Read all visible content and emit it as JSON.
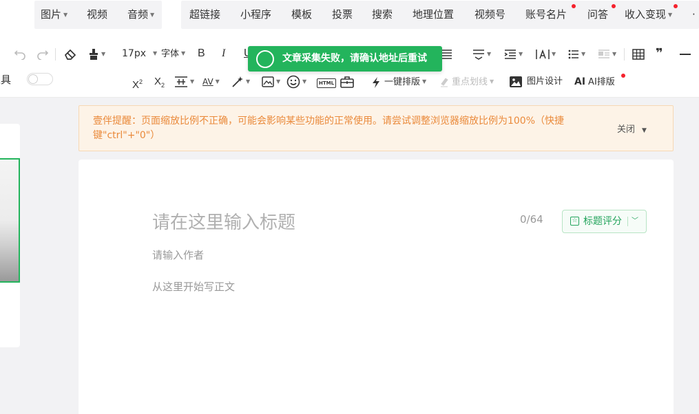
{
  "insert_bar": {
    "group1": [
      {
        "label": "图片",
        "caret": true
      },
      {
        "label": "视频",
        "caret": false
      },
      {
        "label": "音频",
        "caret": true
      }
    ],
    "group2": [
      {
        "label": "超链接",
        "dot": false
      },
      {
        "label": "小程序",
        "dot": false
      },
      {
        "label": "模板",
        "dot": false
      },
      {
        "label": "投票",
        "dot": false
      },
      {
        "label": "搜索",
        "dot": false
      },
      {
        "label": "地理位置",
        "dot": false
      },
      {
        "label": "视频号",
        "dot": false
      },
      {
        "label": "账号名片",
        "dot": true
      },
      {
        "label": "问答",
        "dot": true
      },
      {
        "label": "收入变现",
        "dot": true,
        "caret": true
      }
    ],
    "more": "·",
    "dot_color": "#f5222d"
  },
  "format_toolbar": {
    "undo_icon": "undo-icon",
    "redo_icon": "redo-icon",
    "font_size": "17px",
    "font_label": "字体",
    "bold": "B",
    "italic": "I",
    "underline": "U",
    "superscript_base": "X",
    "superscript": "2",
    "subscript_base": "X",
    "subscript": "2",
    "letter_spacing": "AV",
    "auto_format": "一键排版",
    "highlight": "重点划线",
    "image_design": "图片设计",
    "ai_mark": "AI",
    "ai_format": "AI排版",
    "html_label": "HTML",
    "quote": "❞",
    "tool_label_fragment": "工具"
  },
  "toast": {
    "message": "文章采集失败，请确认地址后重试",
    "color": "#23b45c"
  },
  "warning": {
    "text": "壹伴提醒：页面缩放比例不正确，可能会影响某些功能的正常使用。请尝试调整浏览器缩放比例为100%（快捷键\"ctrl\"+\"0\"）",
    "close_label": "关闭",
    "text_color": "#ea8a3b"
  },
  "editor": {
    "title_placeholder": "请在这里输入标题",
    "title_count": "0/64",
    "score_button": "标题评分",
    "author_placeholder": "请输入作者",
    "body_placeholder": "从这里开始写正文"
  }
}
